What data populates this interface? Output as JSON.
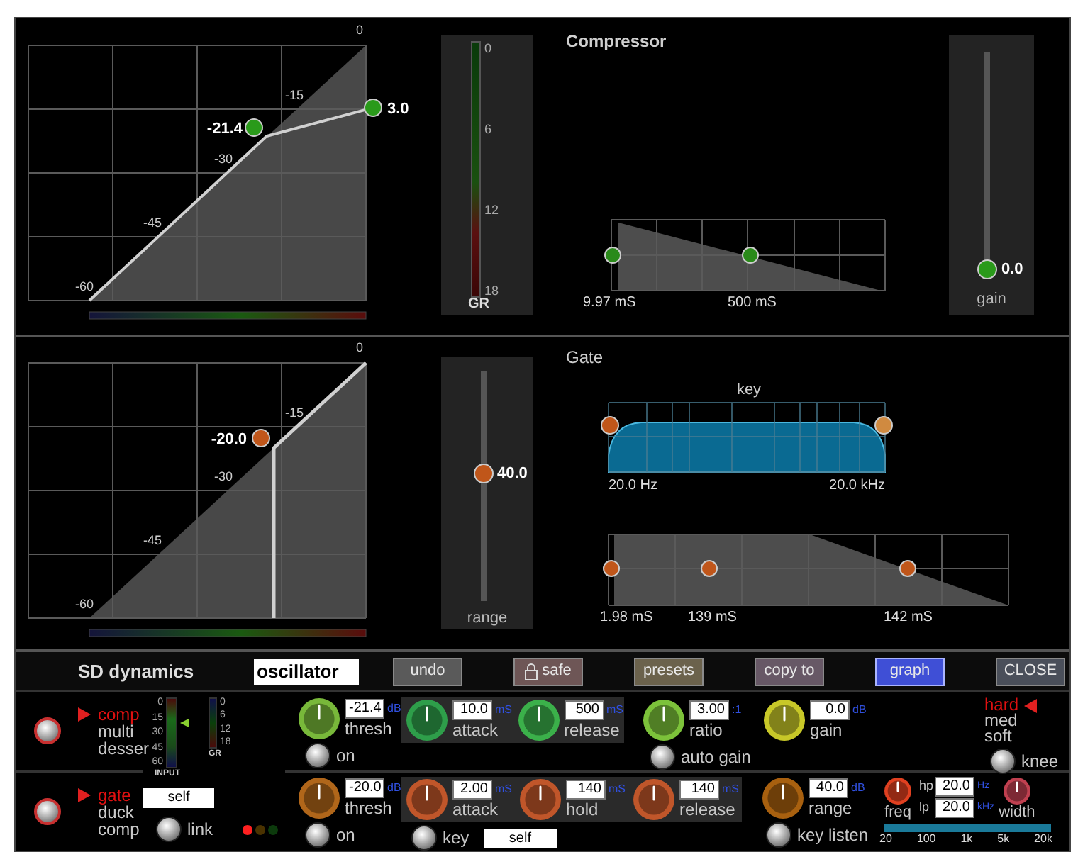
{
  "compressor": {
    "title": "Compressor",
    "curve": {
      "kind": "compressor",
      "ticks": [
        "0",
        "-15",
        "-30",
        "-45",
        "-60"
      ],
      "threshold": "-21.4",
      "ratio_value": "3.0"
    },
    "gr_meter": {
      "scale": [
        "0",
        "6",
        "12",
        "18"
      ],
      "label": "GR"
    },
    "envelope": {
      "kind": "compressor",
      "labels": [
        "9.97 mS",
        "500 mS"
      ]
    },
    "gain_slider": {
      "reading": "0.0",
      "label": "gain",
      "level": 0
    }
  },
  "gate": {
    "title": "Gate",
    "curve": {
      "kind": "gate",
      "ticks": [
        "0",
        "-15",
        "-30",
        "-45",
        "-60"
      ],
      "threshold": "-20.0"
    },
    "range_slider": {
      "reading": "40.0",
      "label": "range",
      "level": 0.56
    },
    "key_graph": {
      "title": "key",
      "low": "20.0 Hz",
      "high": "20.0 kHz"
    },
    "envelope": {
      "kind": "gate",
      "labels": [
        "1.98 mS",
        "139 mS",
        "142 mS"
      ]
    }
  },
  "toolbar": {
    "title": "SD dynamics",
    "preset_name": "oscillator",
    "buttons": [
      {
        "label": "undo",
        "kind": "plain",
        "color": "#5a5a5a",
        "selected": false
      },
      {
        "label": "safe",
        "kind": "lock",
        "color": "#6e5656",
        "selected": false
      },
      {
        "label": "presets",
        "kind": "plain",
        "color": "#6b624c",
        "selected": false
      },
      {
        "label": "copy to",
        "kind": "plain",
        "color": "#675866",
        "selected": false
      },
      {
        "label": "graph",
        "kind": "plain",
        "color": "#3f4fd6",
        "selected": true
      },
      {
        "label": "CLOSE",
        "kind": "plain",
        "color": "#4a4f5a",
        "selected": false
      }
    ]
  },
  "comp_row": {
    "modes": [
      {
        "label": "comp",
        "selected": true
      },
      {
        "label": "multi",
        "selected": false
      },
      {
        "label": "desser",
        "selected": false
      }
    ],
    "input_meter": {
      "scale": [
        "0",
        "15",
        "30",
        "45",
        "60"
      ],
      "label": "INPUT"
    },
    "gr_meter": {
      "scale": [
        "0",
        "6",
        "12",
        "18"
      ],
      "label": "GR"
    },
    "thresh": {
      "label": "thresh",
      "value": "-21.4",
      "unit": "dB",
      "color": "#78b83a"
    },
    "on_label": "on",
    "attack": {
      "label": "attack",
      "value": "10.0",
      "unit": "mS",
      "color": "#2e9e4a"
    },
    "release": {
      "label": "release",
      "value": "500",
      "unit": "mS",
      "color": "#3bb04a"
    },
    "ratio": {
      "label": "ratio",
      "value": "3.00",
      "unit": ":1",
      "color": "#7cc23a"
    },
    "auto_gain_label": "auto gain",
    "gain": {
      "label": "gain",
      "value": "0.0",
      "unit": "dB",
      "color": "#c8c828"
    },
    "knee": {
      "options": [
        {
          "label": "hard",
          "selected": true
        },
        {
          "label": "med",
          "selected": false
        },
        {
          "label": "soft",
          "selected": false
        }
      ],
      "label": "knee"
    }
  },
  "gate_row": {
    "modes": [
      {
        "label": "gate",
        "selected": true
      },
      {
        "label": "duck",
        "selected": false
      },
      {
        "label": "comp",
        "selected": false
      }
    ],
    "key_source": "self",
    "link_label": "link",
    "leds": [
      {
        "color": "#ff2020"
      },
      {
        "color": "#4a3200"
      },
      {
        "color": "#0c3a0c"
      }
    ],
    "thresh": {
      "label": "thresh",
      "value": "-20.0",
      "unit": "dB",
      "color": "#b0661a"
    },
    "on_label": "on",
    "attack": {
      "label": "attack",
      "value": "2.00",
      "unit": "mS",
      "color": "#c0562a"
    },
    "hold": {
      "label": "hold",
      "value": "140",
      "unit": "mS",
      "color": "#c0562a"
    },
    "release": {
      "label": "release",
      "value": "140",
      "unit": "mS",
      "color": "#c0562a"
    },
    "key_label": "key",
    "key_field": "self",
    "range": {
      "label": "range",
      "value": "40.0",
      "unit": "dB",
      "color": "#a8600f"
    },
    "key_listen_label": "key listen",
    "key_filter": {
      "freq": {
        "label": "freq",
        "color": "#e04020"
      },
      "hp": {
        "label": "hp",
        "value": "20.0",
        "unit": "Hz"
      },
      "lp": {
        "label": "lp",
        "value": "20.0",
        "unit": "kHz"
      },
      "width": {
        "label": "width",
        "color": "#c04050"
      },
      "scale": [
        "20",
        "100",
        "1k",
        "5k",
        "20k"
      ]
    }
  }
}
